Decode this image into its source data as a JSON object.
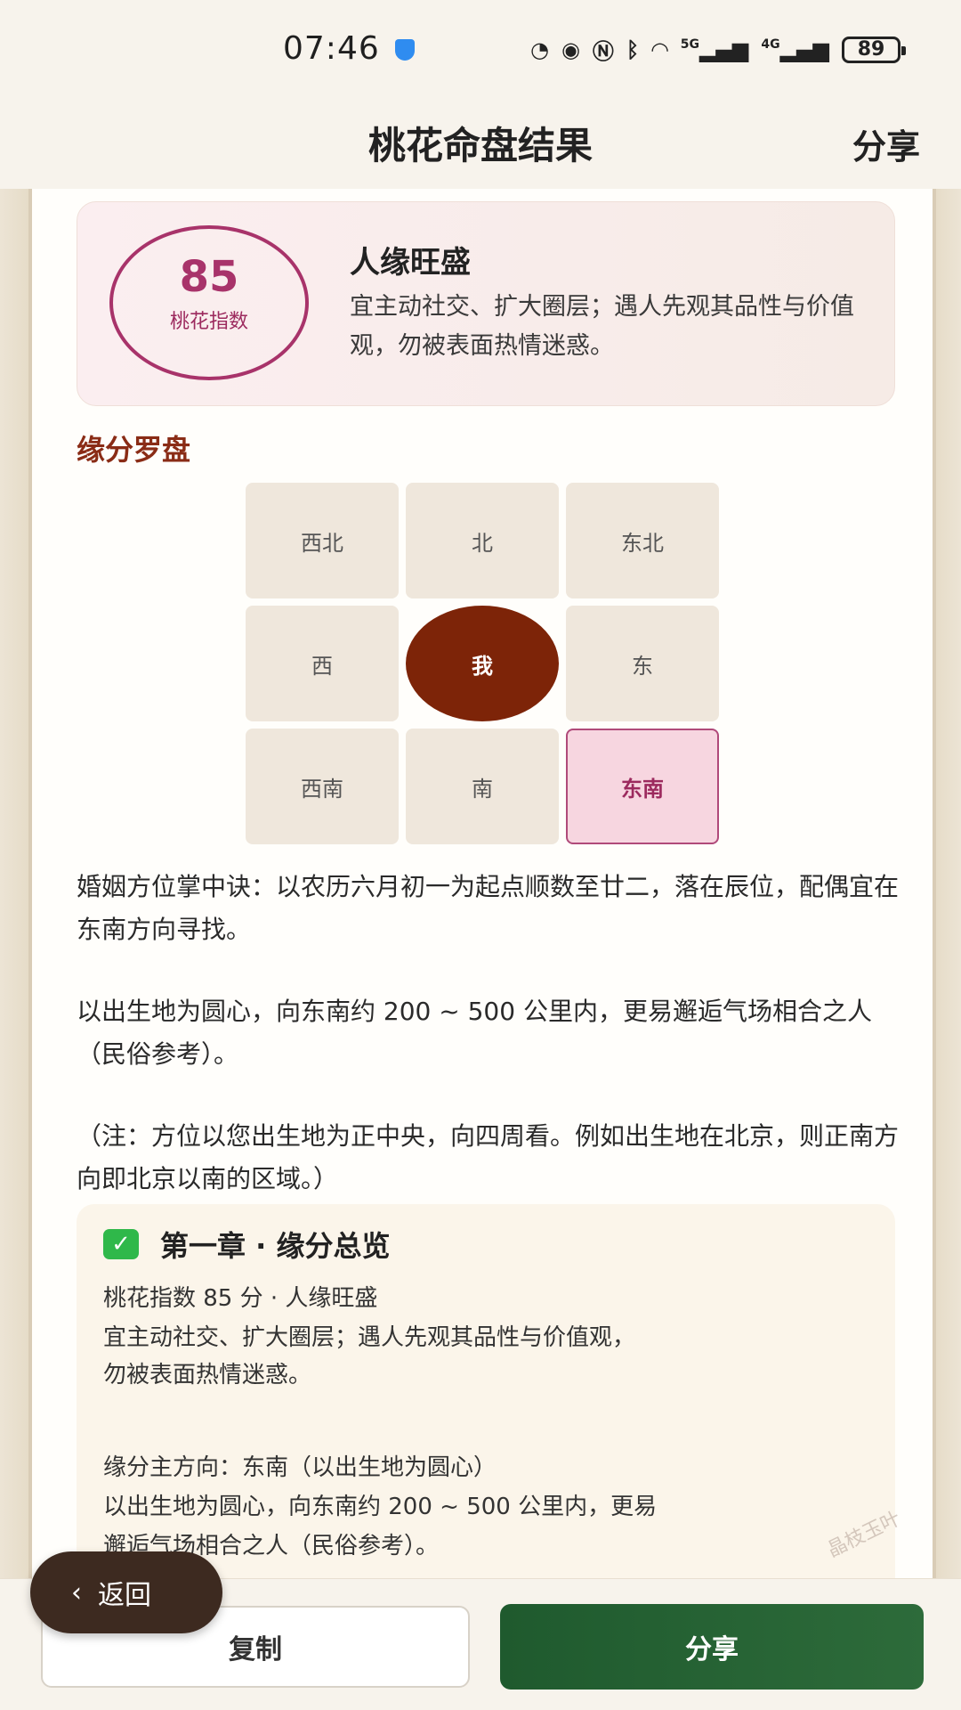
{
  "status_bar": {
    "time": "07:46",
    "icons": [
      "speed-icon",
      "eye-icon",
      "nfc-icon",
      "bluetooth-icon",
      "wifi-icon",
      "5g-signal-icon",
      "4g-signal-icon"
    ],
    "network_5g": "5G",
    "network_4g": "4G",
    "battery": "89"
  },
  "header": {
    "title": "桃花命盘结果",
    "share": "分享"
  },
  "score": {
    "value": "85",
    "label": "桃花指数",
    "headline": "人缘旺盛",
    "description": "宜主动社交、扩大圈层；遇人先观其品性与价值观，勿被表面热情迷惑。"
  },
  "compass": {
    "title": "缘分罗盘",
    "cells": [
      "西北",
      "北",
      "东北",
      "西",
      "我",
      "东",
      "西南",
      "南",
      "东南"
    ],
    "highlighted": "东南"
  },
  "text_blocks": [
    "婚姻方位掌中诀：以农历六月初一为起点顺数至廿二，落在辰位，配偶宜在东南方向寻找。",
    "以出生地为圆心，向东南约 200 ~ 500 公里内，更易邂逅气场相合之人（民俗参考）。",
    "（注：方位以您出生地为正中央，向四周看。例如出生地在北京，则正南方向即北京以南的区域。）"
  ],
  "chapter": {
    "title": "第一章 · 缘分总览",
    "line1": "桃花指数 85 分 · 人缘旺盛",
    "line2": "宜主动社交、扩大圈层；遇人先观其品性与价值观，",
    "line3": "勿被表面热情迷惑。",
    "line4": "缘分主方向：东南（以出生地为圆心）",
    "line5": "以出生地为圆心，向东南约 200 ~ 500 公里内，更易",
    "line6": "邂逅气场相合之人（民俗参考）。"
  },
  "watermark": "晶枝玉叶",
  "buttons": {
    "back": "返回",
    "copy": "复制",
    "share": "分享"
  },
  "colors": {
    "accent": "#a8336a",
    "brown": "#7d2408",
    "green": "#1f5a2e"
  }
}
